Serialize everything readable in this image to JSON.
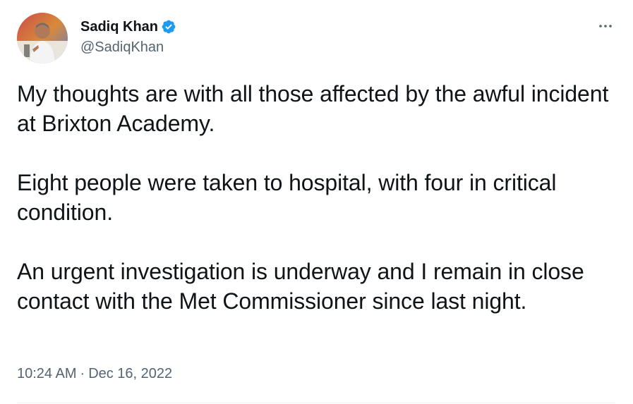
{
  "author": {
    "display_name": "Sadiq Khan",
    "handle": "@SadiqKhan",
    "verified": true,
    "avatar_icon": "profile-photo",
    "verified_icon": "verified-badge-icon",
    "verified_color": "#1d9bf0"
  },
  "menu": {
    "icon": "more-horizontal-icon"
  },
  "tweet": {
    "paragraphs": [
      "My thoughts are with all those affected by the awful incident at Brixton Academy.",
      "Eight people were taken to hospital, with four in critical condition.",
      "An urgent investigation is underway and I remain in close contact with the Met Commissioner since last night."
    ]
  },
  "meta": {
    "time": "10:24 AM",
    "separator": "·",
    "date": "Dec 16, 2022"
  },
  "colors": {
    "text_primary": "#0f1419",
    "text_secondary": "#536471",
    "divider": "#eff3f4"
  }
}
